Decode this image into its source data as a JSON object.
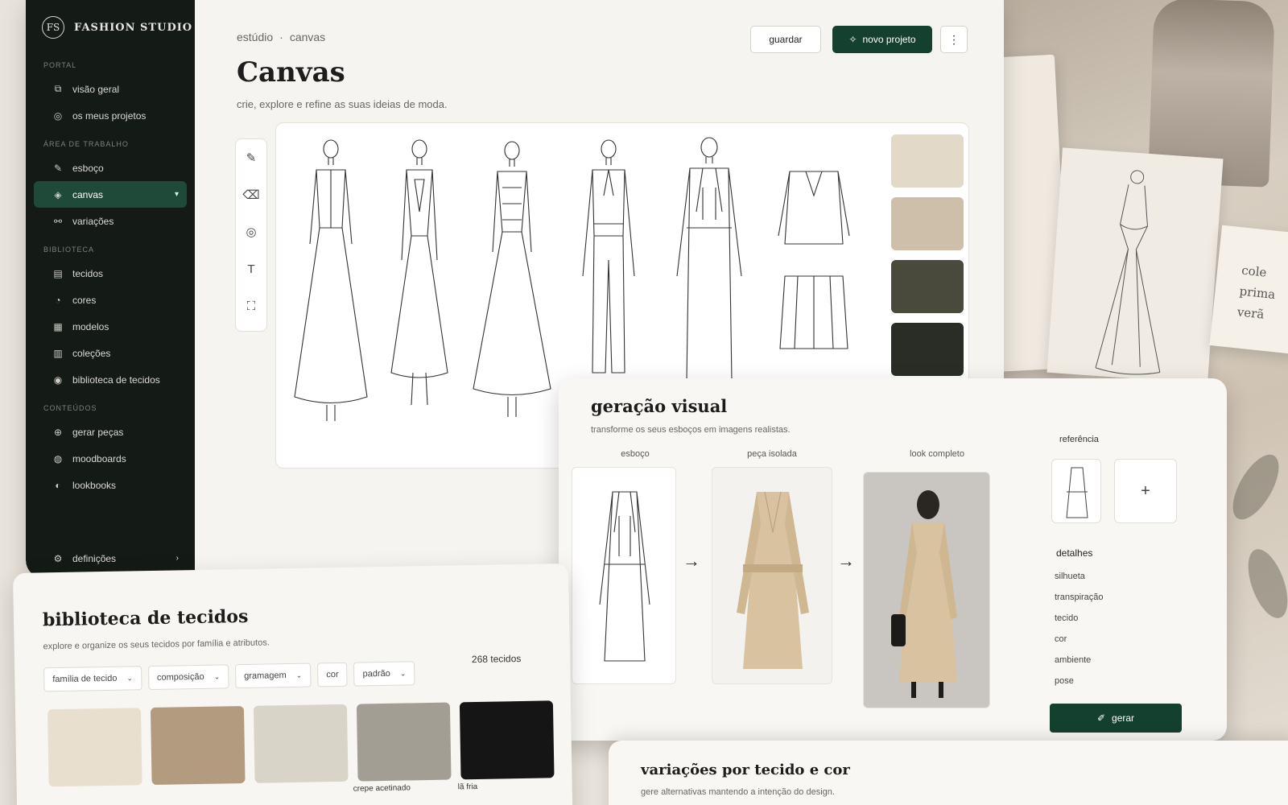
{
  "brand": {
    "logo_mark": "FS",
    "name": "FASHION STUDIO"
  },
  "sidebar": {
    "sections": [
      {
        "title": "PORTAL",
        "items": [
          {
            "label": "visão geral",
            "icon": "overview-icon",
            "glyph": "⧉"
          },
          {
            "label": "os meus projetos",
            "icon": "projects-icon",
            "glyph": "◎"
          }
        ]
      },
      {
        "title": "ÁREA DE TRABALHO",
        "items": [
          {
            "label": "esboço",
            "icon": "sketch-icon",
            "glyph": "✎"
          },
          {
            "label": "canvas",
            "icon": "canvas-icon",
            "glyph": "◈",
            "active": true
          },
          {
            "label": "variações",
            "icon": "variations-icon",
            "glyph": "⚯"
          }
        ]
      },
      {
        "title": "BIBLIOTECA",
        "items": [
          {
            "label": "tecidos",
            "icon": "fabrics-icon",
            "glyph": "▤"
          },
          {
            "label": "cores",
            "icon": "colors-icon",
            "glyph": "◔"
          },
          {
            "label": "modelos",
            "icon": "models-icon",
            "glyph": "▦"
          },
          {
            "label": "coleções",
            "icon": "collections-icon",
            "glyph": "▥"
          },
          {
            "label": "biblioteca de tecidos",
            "icon": "fabric-library-icon",
            "glyph": "◉"
          }
        ]
      },
      {
        "title": "CONTEÚDOS",
        "items": [
          {
            "label": "gerar peças",
            "icon": "generate-icon",
            "glyph": "⊕"
          },
          {
            "label": "moodboards",
            "icon": "moodboards-icon",
            "glyph": "◍"
          },
          {
            "label": "lookbooks",
            "icon": "lookbooks-icon",
            "glyph": "◐"
          }
        ]
      }
    ],
    "settings": {
      "label": "definições",
      "icon": "settings-icon",
      "glyph": "⚙"
    }
  },
  "header": {
    "breadcrumb": [
      "estúdio",
      "canvas"
    ],
    "breadcrumb_sep": "·",
    "title": "Canvas",
    "subtitle": "crie, explore e refine as suas ideias de moda.",
    "save_label": "guardar",
    "new_label": "novo projeto",
    "more_glyph": "⋮"
  },
  "toolbar": {
    "tools": [
      {
        "name": "pencil-icon",
        "glyph": "✎"
      },
      {
        "name": "eraser-icon",
        "glyph": "⌫"
      },
      {
        "name": "fill-icon",
        "glyph": "◎"
      },
      {
        "name": "text-icon",
        "glyph": "T"
      },
      {
        "name": "select-icon",
        "glyph": "⛶"
      }
    ]
  },
  "canvas": {
    "swatch_colors": [
      "#e2d9c9",
      "#cdbfa9",
      "#4a4a3c",
      "#2a2c26"
    ]
  },
  "generation": {
    "title": "geração visual",
    "subtitle": "transforme os seus esboços em imagens realistas.",
    "steps": [
      "esboço",
      "peça isolada",
      "look completo"
    ],
    "arrow_glyph": "→",
    "reference_label": "referência",
    "add_glyph": "+",
    "details_title": "detalhes",
    "details": [
      "silhueta",
      "transpiração",
      "tecido",
      "cor",
      "ambiente",
      "pose"
    ],
    "generate_label": "gerar"
  },
  "library": {
    "title": "biblioteca de tecidos",
    "subtitle": "explore e organize os seus tecidos por família e atributos.",
    "filters": [
      "família de tecido",
      "composição",
      "gramagem",
      "cor",
      "padrão"
    ],
    "count": "268 tecidos",
    "fabric_colors": [
      "#e8dfcf",
      "#b39b80",
      "#d8d4c8",
      "#a29e94",
      "#151515"
    ],
    "fabric_labels": [
      "crepe acetinado",
      "lã fria"
    ]
  },
  "variations": {
    "title": "variações por tecido e cor",
    "subtitle": "gere alternativas mantendo a intenção do design."
  },
  "background": {
    "note_lines": [
      "cole",
      "prima",
      "verã"
    ]
  }
}
